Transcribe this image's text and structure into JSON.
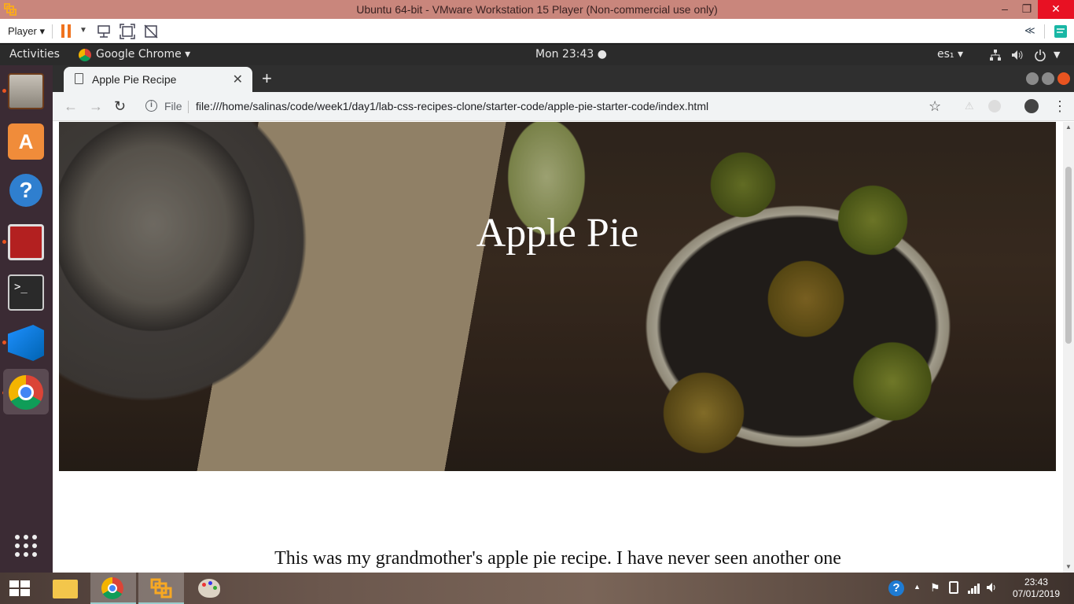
{
  "vmware": {
    "window_title": "Ubuntu 64-bit - VMware Workstation 15 Player (Non-commercial use only)",
    "player_menu": "Player ▾",
    "min": "–",
    "max": "❐",
    "close": "✕",
    "collapse": "≪"
  },
  "ubuntu": {
    "activities": "Activities",
    "app_menu": "Google Chrome ▾",
    "clock": "Mon 23:43 ●",
    "keyboard": "es₁ ▾"
  },
  "chrome": {
    "tab_title": "Apple Pie Recipe",
    "tab_close": "✕",
    "new_tab": "+",
    "back": "←",
    "forward": "→",
    "reload": "↻",
    "info": "i",
    "scheme_label": "File",
    "url": "file:///home/salinas/code/week1/day1/lab-css-recipes-clone/starter-code/apple-pie-starter-code/index.html",
    "star": "☆",
    "menu": "⋮"
  },
  "page": {
    "hero_title": "Apple Pie",
    "intro": "This was my grandmother's apple pie recipe. I have never seen another one"
  },
  "taskbar": {
    "time": "23:43",
    "date": "07/01/2019"
  },
  "colors": {
    "ubuntu_orange": "#e95420",
    "vm_titlebar": "#c9867c"
  }
}
